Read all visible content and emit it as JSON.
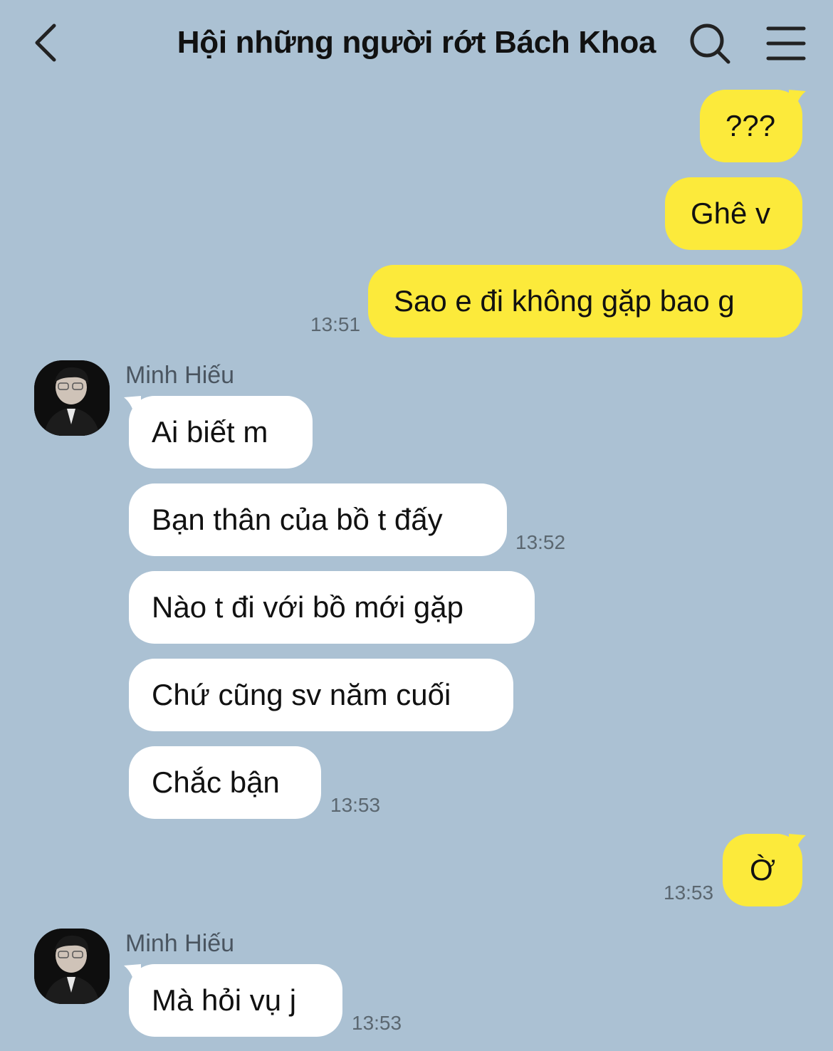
{
  "header": {
    "title": "Hội những người rớt Bách Khoa",
    "back_icon": "chevron-left-icon",
    "search_icon": "search-icon",
    "menu_icon": "hamburger-menu-icon"
  },
  "colors": {
    "background": "#abc1d3",
    "my_bubble": "#fcea3b",
    "their_bubble": "#ffffff"
  },
  "messages": [
    {
      "from": "me",
      "text": "???"
    },
    {
      "from": "me",
      "text": "Ghê v"
    },
    {
      "from": "me",
      "text": "Sao e đi không gặp bao g",
      "time": "13:51"
    },
    {
      "from": "them",
      "sender": "Minh Hiếu",
      "text": "Ai biết m"
    },
    {
      "from": "them",
      "text": "Bạn thân của bồ t đấy",
      "time": "13:52"
    },
    {
      "from": "them",
      "text": "Nào t đi với bồ mới gặp"
    },
    {
      "from": "them",
      "text": "Chứ cũng sv năm cuối"
    },
    {
      "from": "them",
      "text": "Chắc bận",
      "time": "13:53"
    },
    {
      "from": "me",
      "text": "Ờ",
      "time": "13:53"
    },
    {
      "from": "them",
      "sender": "Minh Hiếu",
      "text": "Mà hỏi vụ j",
      "time": "13:53"
    }
  ]
}
